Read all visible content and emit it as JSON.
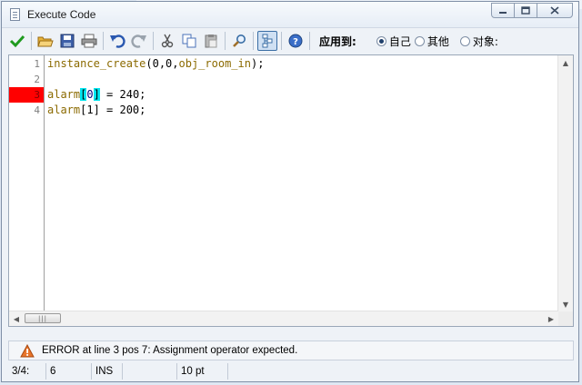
{
  "window": {
    "title": "Execute Code"
  },
  "toolbar": {
    "apply_to_label": "应用到:",
    "radios": [
      {
        "label": "自己",
        "checked": true
      },
      {
        "label": "其他",
        "checked": false
      },
      {
        "label": "对象:",
        "checked": false
      }
    ],
    "icons": [
      "checkmark-icon",
      "open-folder-icon",
      "save-disk-icon",
      "printer-icon",
      "undo-icon",
      "redo-icon",
      "cut-icon",
      "copy-icon",
      "paste-icon",
      "find-icon",
      "code-tree-icon",
      "help-icon"
    ]
  },
  "editor": {
    "lines": [
      {
        "number": "1",
        "error": false
      },
      {
        "number": "2",
        "error": false
      },
      {
        "number": "3",
        "error": true
      },
      {
        "number": "4",
        "error": false
      }
    ],
    "code": {
      "line1": {
        "fn": "instance_create",
        "args": "(0,0,",
        "obj": "obj_room_in",
        "tail": ");"
      },
      "line3": {
        "kw": "alarm",
        "open": "[",
        "idx": "0",
        "close": "]",
        "rest": " = 240;"
      },
      "line4": {
        "kw": "alarm",
        "idx_text": "[1]",
        "rest": " = 200;"
      }
    },
    "colors": {
      "error_gutter": "#ff0000",
      "bracket_highlight": "#00e5ef"
    }
  },
  "message": {
    "text": "ERROR at line 3 pos 7: Assignment operator expected."
  },
  "statusbar": {
    "position": "3/4:",
    "column": "6",
    "mode": "INS",
    "font_size": "10 pt"
  }
}
